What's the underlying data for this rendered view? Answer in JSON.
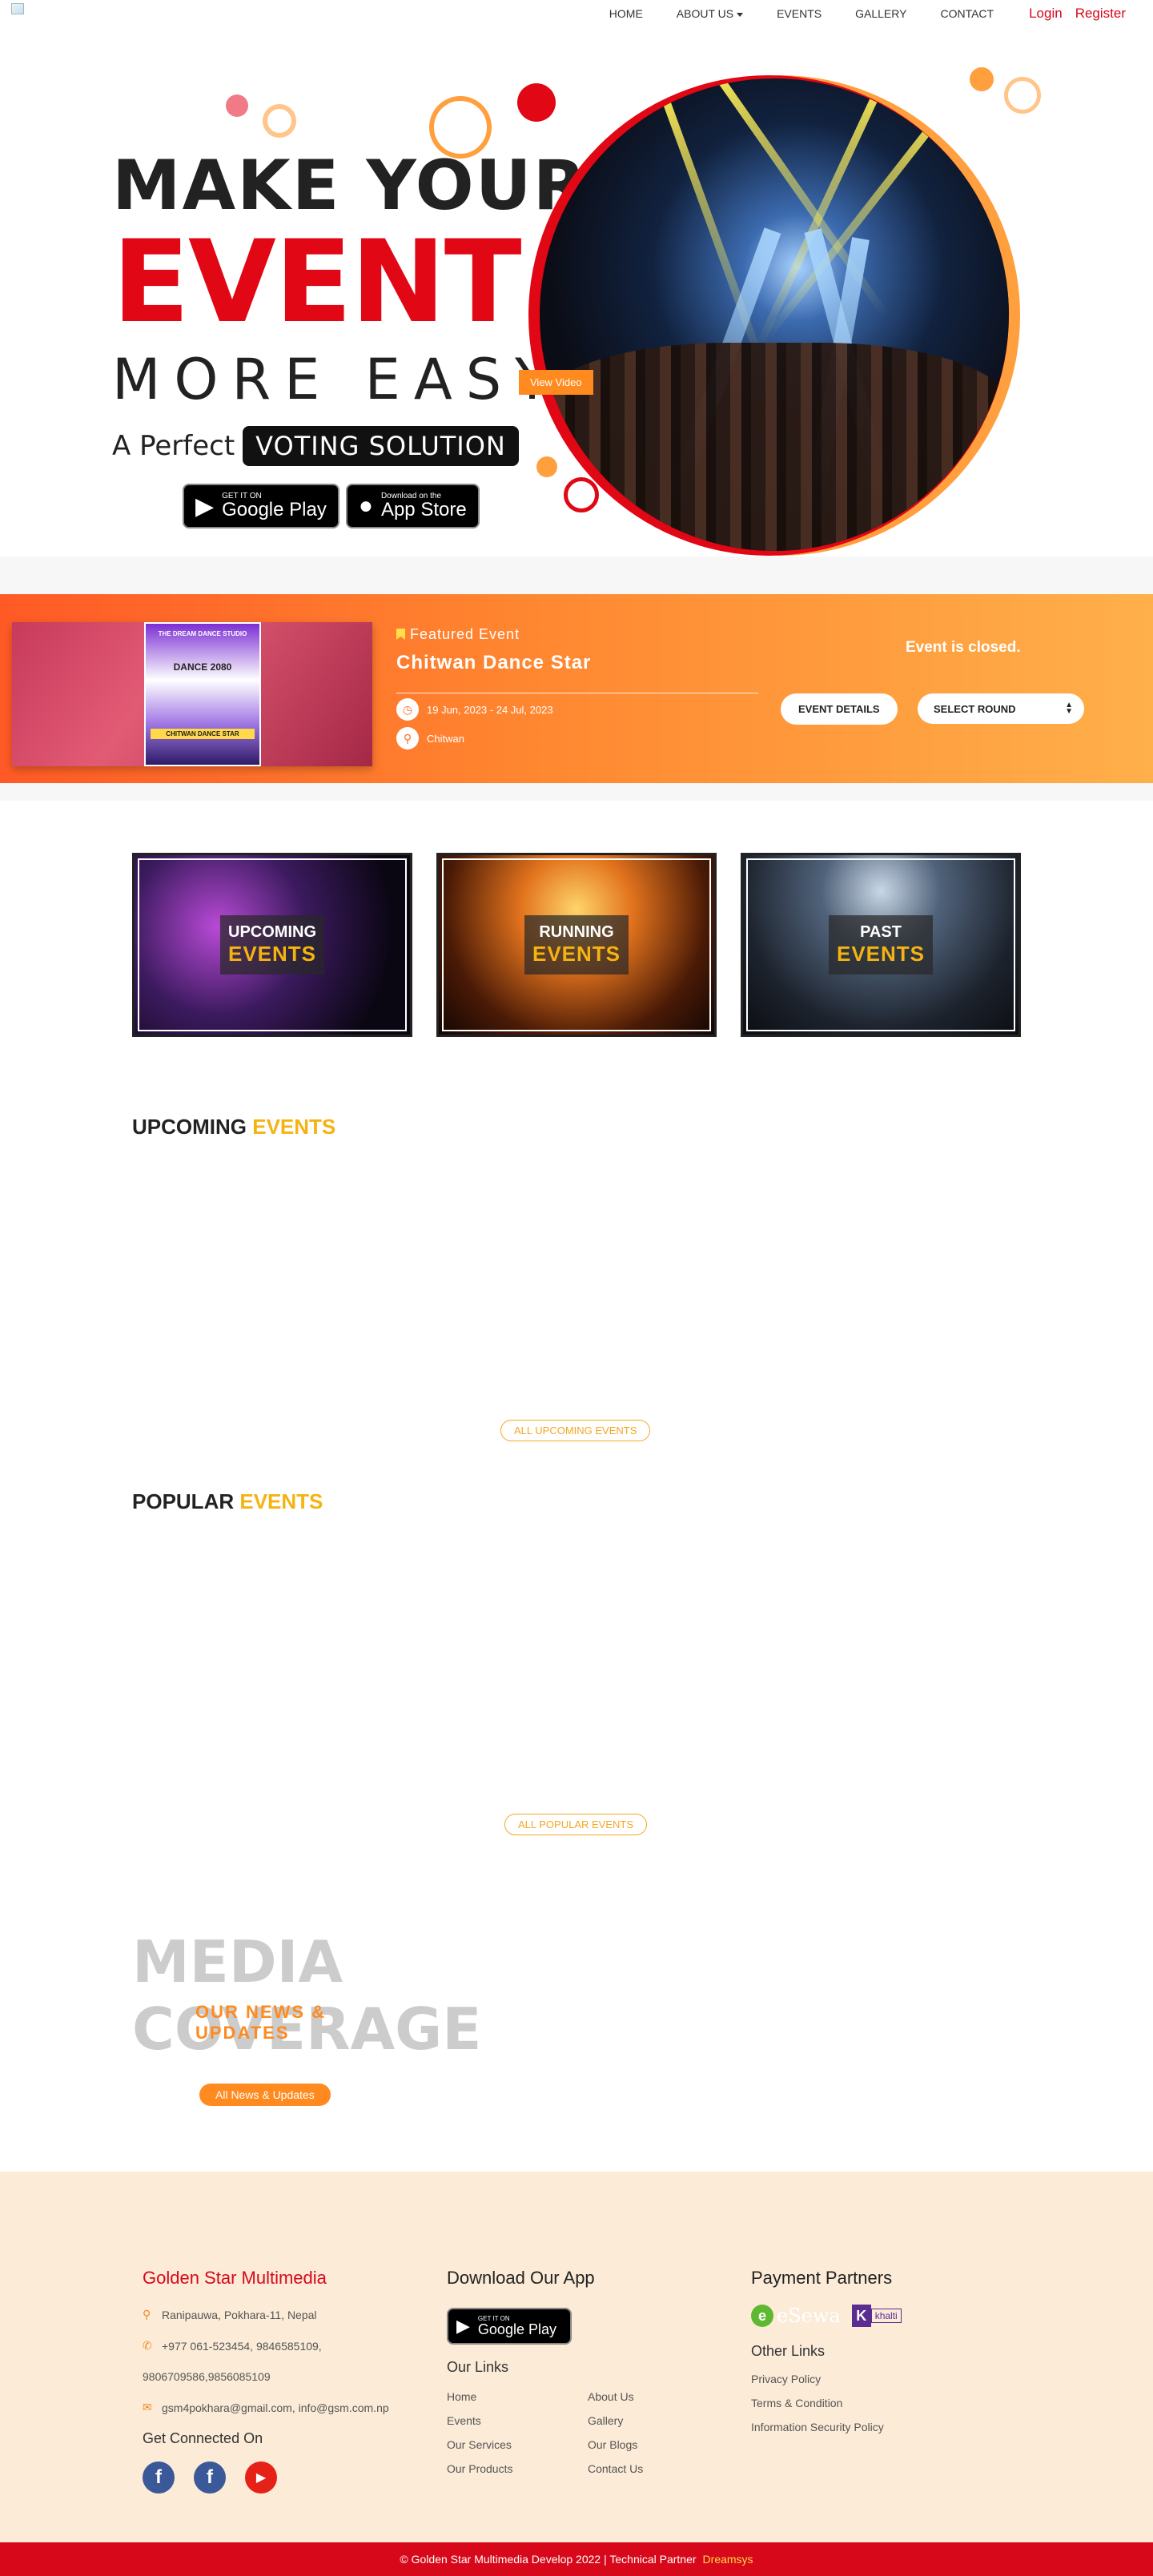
{
  "nav": {
    "items": [
      {
        "label": "HOME"
      },
      {
        "label": "ABOUT US"
      },
      {
        "label": "EVENTS"
      },
      {
        "label": "GALLERY"
      },
      {
        "label": "CONTACT"
      }
    ],
    "login": "Login",
    "register": "Register"
  },
  "hero": {
    "line1": "MAKE YOUR",
    "line2": "EVENT",
    "line3": "MORE EASY",
    "perfect": "A Perfect",
    "tag": "VOTING SOLUTION",
    "view_video": "View Video",
    "google_small": "GET IT ON",
    "google_big": "Google Play",
    "apple_small": "Download on the",
    "apple_big": "App Store"
  },
  "featured": {
    "label": "Featured Event",
    "title": "Chitwan Dance Star",
    "dates": "19 Jun, 2023 - 24 Jul, 2023",
    "location": "Chitwan",
    "status": "Event is closed.",
    "details_button": "EVENT DETAILS",
    "select_round": "SELECT ROUND",
    "poster_text_1": "THE DREAM DANCE STUDIO",
    "poster_text_2": "DANCE 2080",
    "poster_text_3": "CHITWAN DANCE STAR"
  },
  "categories": [
    {
      "line1": "UPCOMING",
      "line2": "EVENTS"
    },
    {
      "line1": "RUNNING",
      "line2": "EVENTS"
    },
    {
      "line1": "PAST",
      "line2": "EVENTS"
    }
  ],
  "upcoming": {
    "title_a": "UPCOMING",
    "title_b": "EVENTS",
    "button": "ALL UPCOMING EVENTS"
  },
  "popular": {
    "title_a": "POPULAR",
    "title_b": "EVENTS",
    "button": "ALL POPULAR EVENTS"
  },
  "media": {
    "line1": "MEDIA",
    "line2": "COVERAGE",
    "sub1": "OUR NEWS &",
    "sub2": "UPDATES",
    "button": "All News & Updates"
  },
  "footer": {
    "company": "Golden Star Multimedia",
    "address": "Ranipauwa, Pokhara-11, Nepal",
    "phone1": "+977 061-523454, 9846585109,",
    "phone2": "9806709586,9856085109",
    "email": "gsm4pokhara@gmail.com, info@gsm.com.np",
    "connected": "Get Connected On",
    "download_title": "Download Our App",
    "google_small": "GET IT ON",
    "google_big": "Google Play",
    "links_title": "Our Links",
    "links": [
      "Home",
      "About Us",
      "Events",
      "Gallery",
      "Our Services",
      "Our Blogs",
      "Our Products",
      "Contact Us"
    ],
    "payment_title": "Payment Partners",
    "esewa": "eSewa",
    "khalti": "khalti",
    "other_title": "Other Links",
    "other_links": [
      "Privacy Policy",
      "Terms & Condition",
      "Information Security Policy"
    ],
    "copyright": "© Golden Star Multimedia Develop 2022 | Technical Partner",
    "partner": "Dreamsys"
  },
  "colors": {
    "brand_red": "#d7081a",
    "accent_orange": "#ff8a1f",
    "accent_yellow": "#f5b312",
    "footer_bg": "#fbebd7"
  }
}
